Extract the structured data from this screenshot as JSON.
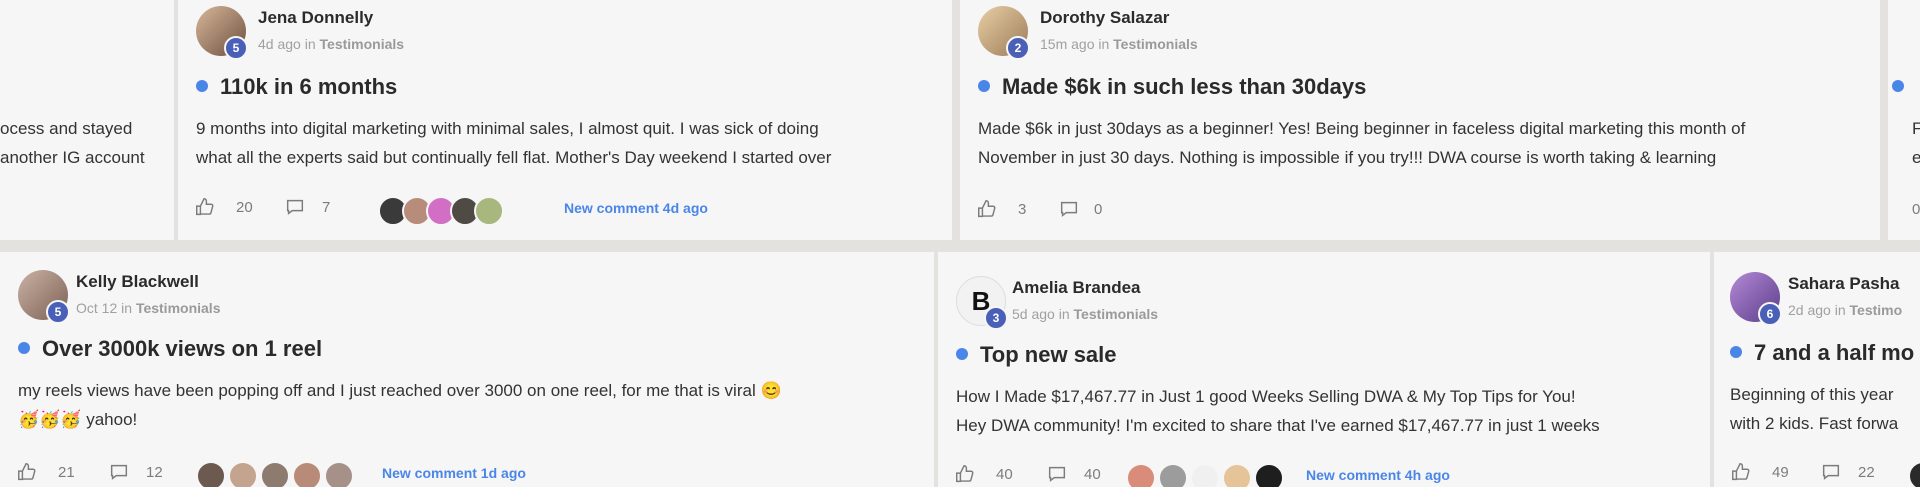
{
  "left_partial": {
    "line1": "ocess and stayed",
    "line2": "another IG account"
  },
  "posts": [
    {
      "author": "Jena Donnelly",
      "level": "5",
      "time": "4d ago",
      "in_word": "in",
      "category": "Testimonials",
      "title": "110k in 6 months",
      "body1": "9 months into digital marketing with minimal sales, I almost quit. I was sick of doing",
      "body2": "what all the experts said but continually fell flat. Mother's Day weekend I started over",
      "likes": "20",
      "comments": "7",
      "new_comment": "New comment 4d ago"
    },
    {
      "author": "Dorothy Salazar",
      "level": "2",
      "time": "15m ago",
      "in_word": "in",
      "category": "Testimonials",
      "title": "Made $6k in such less than 30days",
      "body1": "Made $6k in just 30days as a beginner! Yes! Being beginner in faceless digital marketing this month of",
      "body2": "November in just 30 days. Nothing is impossible if you try!!! DWA course is worth taking & learning",
      "likes": "3",
      "comments": "0"
    },
    {
      "author": "Kelly Blackwell",
      "level": "5",
      "time": "Oct 12",
      "in_word": "in",
      "category": "Testimonials",
      "title": "Over 3000k views on 1 reel",
      "body1": "my reels views have been popping off and I just reached over 3000 on one reel, for me that is viral 😊",
      "body2": "🥳🥳🥳 yahoo!",
      "likes": "21",
      "comments": "12",
      "new_comment": "New comment 1d ago"
    },
    {
      "author": "Amelia Brandea",
      "level": "3",
      "time": "5d ago",
      "in_word": "in",
      "category": "Testimonials",
      "title": "Top new sale",
      "body1": "How I Made $17,467.77 in Just 1 good Weeks Selling DWA & My Top Tips for You!",
      "body2": "Hey DWA community! I'm excited to share that I've earned $17,467.77 in just 1 weeks",
      "likes": "40",
      "comments": "40",
      "new_comment": "New comment 4h ago",
      "avatar_letter": "B"
    },
    {
      "author": "Sahara Pasha",
      "level": "6",
      "time": "2d ago",
      "in_word": "in",
      "category": "Testimo",
      "title": "7 and a half mo",
      "body1": "Beginning of this year",
      "body2": "with 2 kids. Fast forwa",
      "likes": "49",
      "comments": "22"
    }
  ],
  "right_partial": {
    "line1": "F",
    "line2": "e",
    "count": "0"
  },
  "icons": {
    "like": "thumbs-up-icon",
    "comment": "comment-bubble-icon"
  },
  "colors": {
    "accent": "#4a86e8",
    "level_badge": "#4a60b8",
    "page_bg": "#e4e2de",
    "card_bg": "#f6f6f6"
  }
}
